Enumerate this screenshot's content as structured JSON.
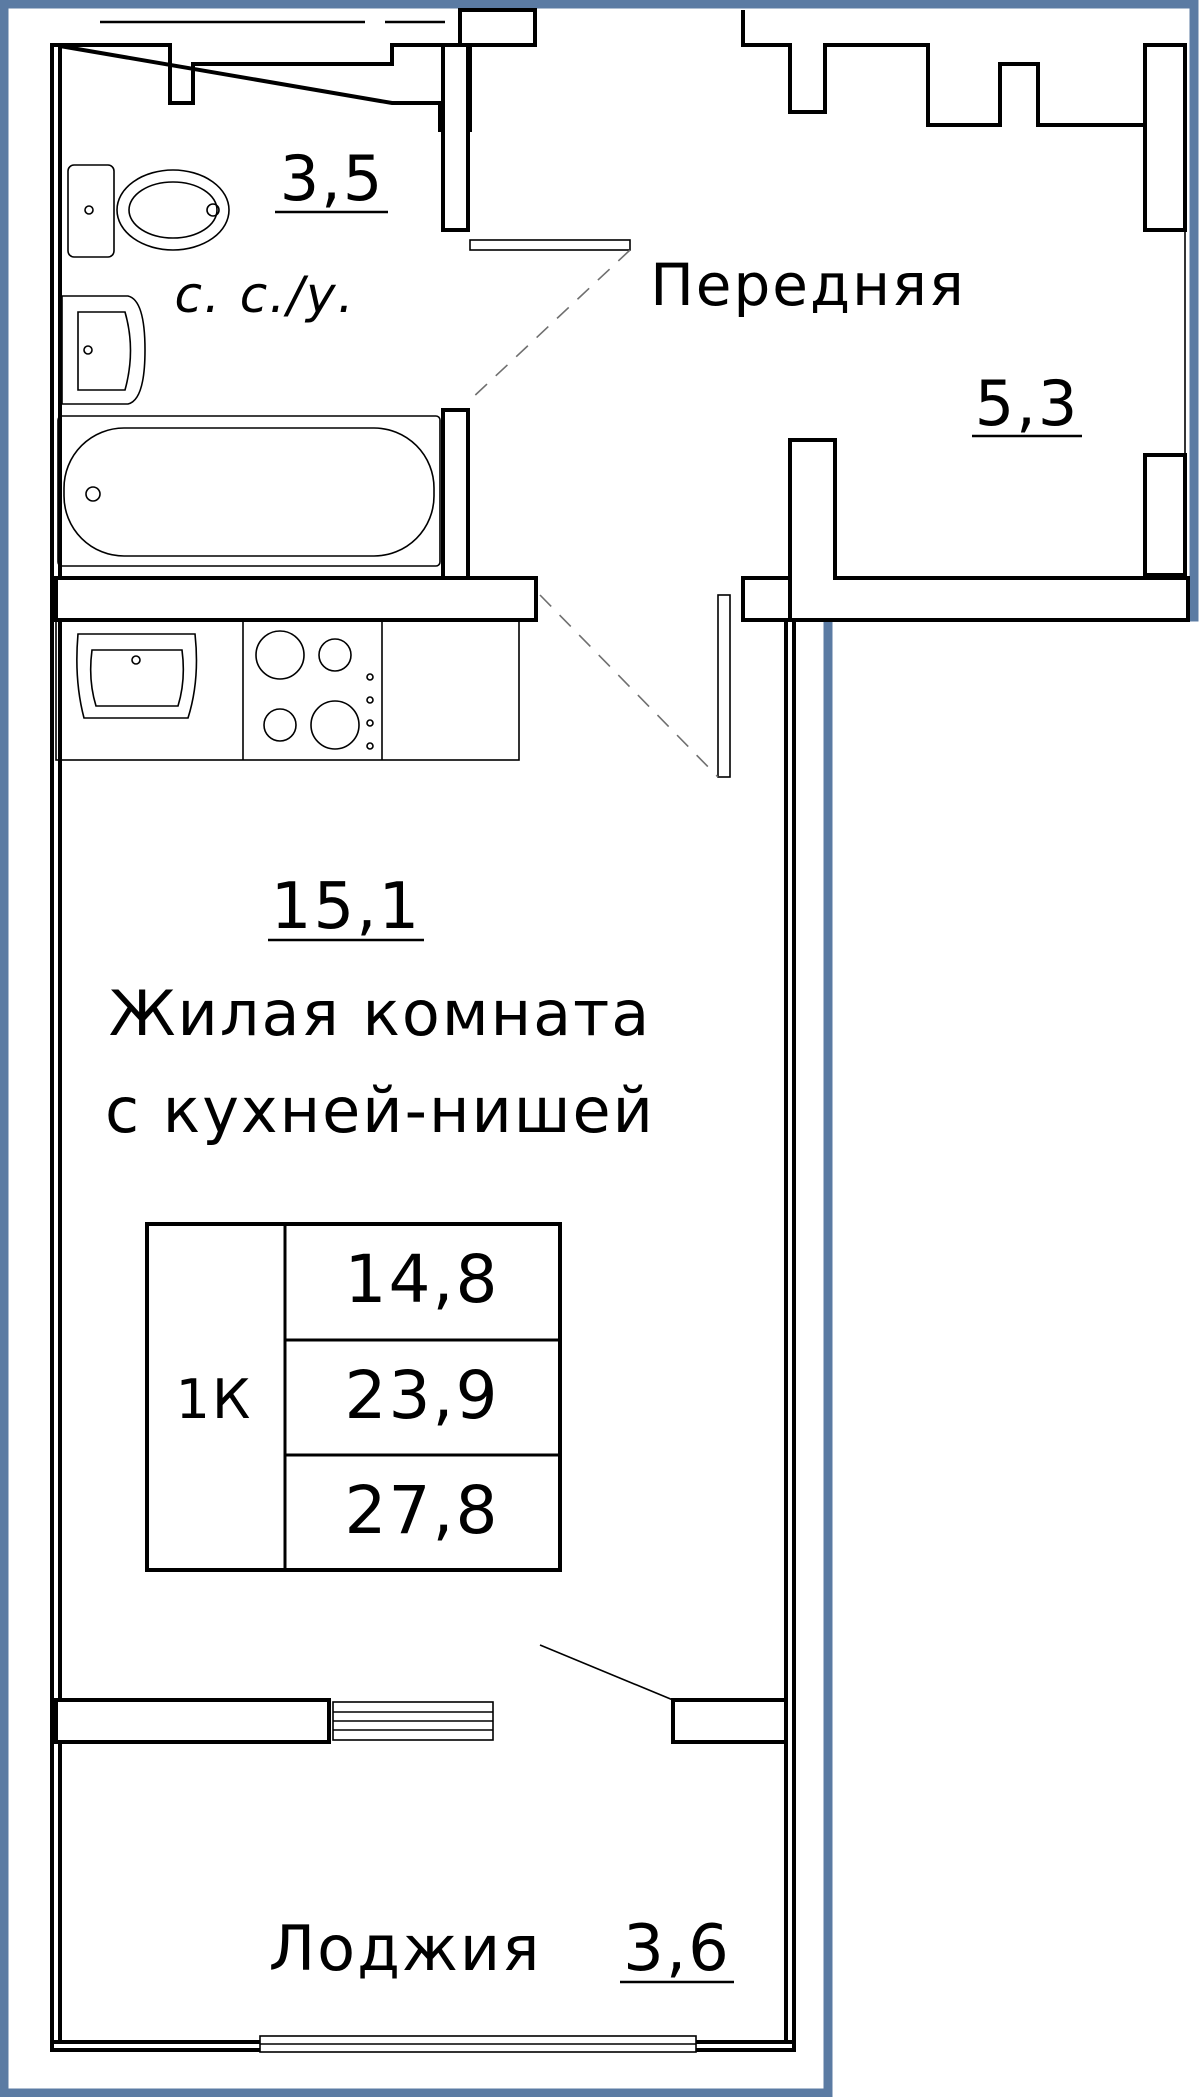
{
  "rooms": {
    "bathroom": {
      "area": "3,5",
      "name": "с. с./у."
    },
    "hall": {
      "name": "Передняя",
      "area": "5,3"
    },
    "living": {
      "area": "15,1",
      "name_line1": "Жилая комната",
      "name_line2": "с кухней-нишей"
    },
    "loggia": {
      "name": "Лоджия",
      "area": "3,6"
    }
  },
  "summary": {
    "type": "1К",
    "living_area": "14,8",
    "total_area": "23,9",
    "total_with_loggia": "27,8"
  },
  "colors": {
    "frame": "#5b7ba3",
    "walls": "#000000",
    "background": "#ffffff"
  }
}
